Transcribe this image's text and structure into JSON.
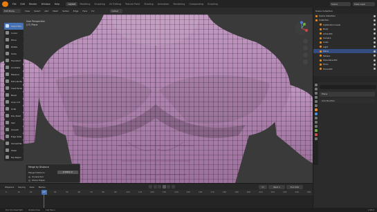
{
  "topbar": {
    "menus": [
      "File",
      "Edit",
      "Render",
      "Window",
      "Help"
    ],
    "workspaces": [
      "Layout",
      "Modeling",
      "Sculpting",
      "UV Editing",
      "Texture Paint",
      "Shading",
      "Animation",
      "Rendering",
      "Compositing",
      "Scripting"
    ],
    "active_workspace": "Layout",
    "scene": "Scene",
    "view_layer": "View Layer"
  },
  "viewport_header": {
    "mode": "Edit Mode",
    "menus": [
      "View",
      "Select",
      "Add",
      "Mesh",
      "Vertex",
      "Edge",
      "Face",
      "UV"
    ],
    "orientation": "Global"
  },
  "viewport": {
    "view_name": "User Perspective",
    "object_name": "(17) Plane"
  },
  "toolbar": {
    "tools": [
      "Select Box",
      "Cursor",
      "Move",
      "Rotate",
      "Scale",
      "Transform",
      "Annotate",
      "Measure",
      "Extrude Re",
      "Inset Faces",
      "Bevel",
      "Loop Cut",
      "Knife",
      "Poly Build",
      "Spin",
      "Smooth",
      "Edge Slide",
      "Shrink/Flat",
      "Shear",
      "Rip Region"
    ],
    "active_index": 0
  },
  "operator_panel": {
    "title": "Merge by Distance",
    "merge_distance_label": "Merge Distance",
    "merge_distance_value": "0.0001 m",
    "unselected_label": "Unselected",
    "sharp_edges_label": "Sharp Edges"
  },
  "outliner": {
    "title": "Scene Collection",
    "items": [
      {
        "label": "Scene Collection",
        "selected": false
      },
      {
        "label": "Collection",
        "selected": false
      },
      {
        "label": "Subdivision Level",
        "selected": false
      },
      {
        "label": "Body",
        "selected": false
      },
      {
        "label": "Arms.001",
        "selected": false
      },
      {
        "label": "Camera",
        "selected": false
      },
      {
        "label": "Cube",
        "selected": false
      },
      {
        "label": "Light",
        "selected": false
      },
      {
        "label": "Plane",
        "selected": true
      },
      {
        "label": "Sphere",
        "selected": false
      },
      {
        "label": "Shoulders.001",
        "selected": false
      },
      {
        "label": "Torso",
        "selected": false
      },
      {
        "label": "Torso.001",
        "selected": false
      }
    ]
  },
  "properties": {
    "object_name": "Plane",
    "modifier_button": "Add Modifier"
  },
  "timeline": {
    "menus": [
      "Playback",
      "Keying",
      "View",
      "Marker"
    ],
    "current_frame": "17",
    "start_label": "Start",
    "start_value": "1",
    "end_label": "End",
    "end_value": "250",
    "ticks": [
      "0",
      "10",
      "20",
      "30",
      "40",
      "50",
      "60",
      "70",
      "80",
      "90",
      "100",
      "110",
      "120",
      "130",
      "140",
      "150",
      "160",
      "170",
      "180",
      "190",
      "200",
      "210",
      "220",
      "230",
      "240",
      "250"
    ]
  },
  "statusbar": {
    "items": [
      "Pick Shortest Path",
      "Rotate View",
      "Call Menu"
    ],
    "version": "2.90.0"
  },
  "colors": {
    "accent": "#4772b3",
    "mesh": "#b488b4",
    "viewport_bg": "#3a3a3a",
    "object_icon": "#e08a2e"
  }
}
